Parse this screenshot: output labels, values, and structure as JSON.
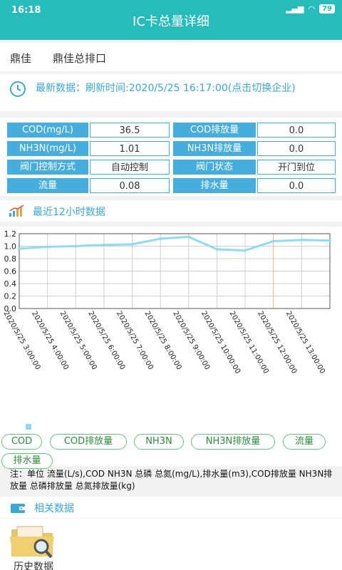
{
  "status_bar": {
    "time": "16:18",
    "battery": "79"
  },
  "header": {
    "title": "IC卡总量详细"
  },
  "company": {
    "name": "鼎佳",
    "outlet": "鼎佳总排口"
  },
  "refresh": {
    "text": "最新数据：刷新时间:2020/5/25 16:17:00(点击切换企业)"
  },
  "metrics": [
    {
      "label": "COD(mg/L)",
      "value": "36.5",
      "label2": "COD排放量",
      "value2": "0.0"
    },
    {
      "label": "NH3N(mg/L)",
      "value": "1.01",
      "label2": "NH3N排放量",
      "value2": "0.0"
    },
    {
      "label": "阀门控制方式",
      "value": "自动控制",
      "label2": "阀门状态",
      "value2": "开门到位"
    },
    {
      "label": "流量",
      "value": "0.08",
      "label2": "排水量",
      "value2": "0.0"
    }
  ],
  "chart_section": {
    "title": "最近12小时数据"
  },
  "chart_data": {
    "type": "line",
    "categories": [
      "2020/5/25 3:00:00",
      "2020/5/25 4:00:00",
      "2020/5/25 5:00:00",
      "2020/5/25 6:00:00",
      "2020/5/25 7:00:00",
      "2020/5/25 8:00:00",
      "2020/5/25 9:00:00",
      "2020/5/25 10:00:00",
      "2020/5/25 11:00:00",
      "2020/5/25 12:00:00",
      "2020/5/25 13:00:00"
    ],
    "series": [
      {
        "values": [
          0.96,
          0.99,
          1.0,
          1.02,
          1.03,
          1.12,
          1.15,
          0.95,
          0.93,
          1.08,
          1.1,
          1.09
        ]
      }
    ],
    "yticks": [
      "0.0",
      "0.2",
      "0.4",
      "0.6",
      "0.8",
      "1.0",
      "1.2"
    ],
    "ylim": [
      0,
      1.2
    ],
    "grid": true,
    "line_color": "#8edcf3"
  },
  "legend_chips": [
    "COD",
    "COD排放量",
    "NH3N",
    "NH3N排放量",
    "流量",
    "排水量"
  ],
  "note": "注：单位 流量(L/s),COD NH3N 总磷 总氮(mg/L),排水量(m3),COD排放量 NH3N排放量 总磷排放量 总氮排放量(kg)",
  "related": {
    "title": "相关数据",
    "history_label": "历史数据"
  },
  "colors": {
    "teal": "#26bcbc",
    "label_blue": "#46aede",
    "link_blue": "#3aa7d8",
    "chip_green": "#69c37a"
  }
}
